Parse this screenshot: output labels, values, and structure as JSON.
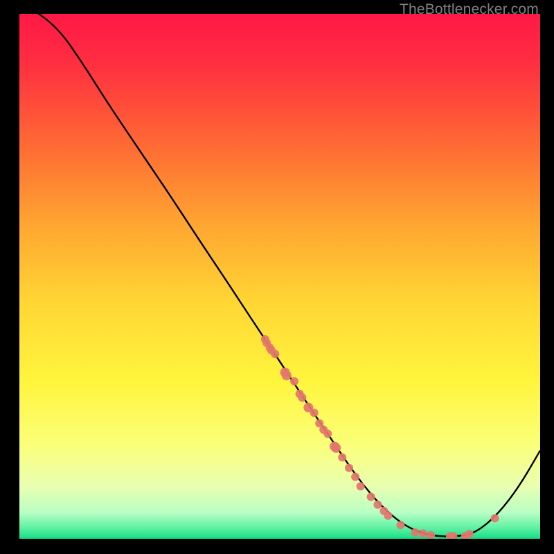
{
  "attribution": "TheBottlenecker.com",
  "chart_data": {
    "type": "line",
    "title": "",
    "xlabel": "",
    "ylabel": "",
    "xlim": [
      0,
      100
    ],
    "ylim": [
      0,
      100
    ],
    "grid": false,
    "colors": {
      "curve": "#000000",
      "points": "#e3766c",
      "gradient_top": "#ff1a49",
      "gradient_mid_high": "#ff7a2e",
      "gradient_mid": "#ffe838",
      "gradient_low": "#f7ffc6",
      "gradient_bottom": "#17dd86"
    },
    "curve": [
      {
        "x": 0.0,
        "y": 102.0
      },
      {
        "x": 4.0,
        "y": 100.0
      },
      {
        "x": 8.0,
        "y": 96.5
      },
      {
        "x": 12.0,
        "y": 90.8
      },
      {
        "x": 16.0,
        "y": 84.5
      },
      {
        "x": 20.0,
        "y": 78.5
      },
      {
        "x": 25.0,
        "y": 71.2
      },
      {
        "x": 30.0,
        "y": 63.8
      },
      {
        "x": 35.0,
        "y": 56.2
      },
      {
        "x": 40.0,
        "y": 48.8
      },
      {
        "x": 45.0,
        "y": 41.2
      },
      {
        "x": 50.0,
        "y": 33.8
      },
      {
        "x": 55.0,
        "y": 26.2
      },
      {
        "x": 60.0,
        "y": 18.8
      },
      {
        "x": 65.0,
        "y": 11.5
      },
      {
        "x": 70.0,
        "y": 5.6
      },
      {
        "x": 75.0,
        "y": 1.8
      },
      {
        "x": 80.0,
        "y": 0.4
      },
      {
        "x": 85.0,
        "y": 0.5
      },
      {
        "x": 88.0,
        "y": 1.4
      },
      {
        "x": 92.0,
        "y": 4.8
      },
      {
        "x": 96.0,
        "y": 10.0
      },
      {
        "x": 100.0,
        "y": 16.8
      }
    ],
    "points": [
      {
        "x": 47.2,
        "y": 38.0,
        "r": 6
      },
      {
        "x": 47.5,
        "y": 37.3,
        "r": 6
      },
      {
        "x": 48.1,
        "y": 36.4,
        "r": 6
      },
      {
        "x": 48.4,
        "y": 35.9,
        "r": 6
      },
      {
        "x": 49.1,
        "y": 35.2,
        "r": 6
      },
      {
        "x": 51.0,
        "y": 31.7,
        "r": 7
      },
      {
        "x": 51.3,
        "y": 31.1,
        "r": 7
      },
      {
        "x": 52.8,
        "y": 30.0,
        "r": 6
      },
      {
        "x": 53.8,
        "y": 27.6,
        "r": 6
      },
      {
        "x": 54.3,
        "y": 26.9,
        "r": 6
      },
      {
        "x": 55.5,
        "y": 25.0,
        "r": 7
      },
      {
        "x": 56.6,
        "y": 24.0,
        "r": 6
      },
      {
        "x": 57.6,
        "y": 22.0,
        "r": 6
      },
      {
        "x": 58.4,
        "y": 20.8,
        "r": 6
      },
      {
        "x": 59.2,
        "y": 20.0,
        "r": 6
      },
      {
        "x": 60.5,
        "y": 17.6,
        "r": 7
      },
      {
        "x": 60.8,
        "y": 17.3,
        "r": 7
      },
      {
        "x": 62.0,
        "y": 15.5,
        "r": 6
      },
      {
        "x": 63.3,
        "y": 13.5,
        "r": 6
      },
      {
        "x": 64.5,
        "y": 11.8,
        "r": 6
      },
      {
        "x": 65.5,
        "y": 10.0,
        "r": 6
      },
      {
        "x": 67.5,
        "y": 8.0,
        "r": 6
      },
      {
        "x": 68.8,
        "y": 6.5,
        "r": 6
      },
      {
        "x": 70.0,
        "y": 5.3,
        "r": 6
      },
      {
        "x": 70.8,
        "y": 4.4,
        "r": 6
      },
      {
        "x": 73.2,
        "y": 2.6,
        "r": 6
      },
      {
        "x": 76.0,
        "y": 1.2,
        "r": 6
      },
      {
        "x": 77.5,
        "y": 1.0,
        "r": 6
      },
      {
        "x": 79.0,
        "y": 0.7,
        "r": 6
      },
      {
        "x": 82.7,
        "y": 0.5,
        "r": 6
      },
      {
        "x": 83.3,
        "y": 0.5,
        "r": 6
      },
      {
        "x": 85.6,
        "y": 0.5,
        "r": 6
      },
      {
        "x": 86.4,
        "y": 0.9,
        "r": 6
      },
      {
        "x": 91.3,
        "y": 3.9,
        "r": 6
      }
    ]
  }
}
